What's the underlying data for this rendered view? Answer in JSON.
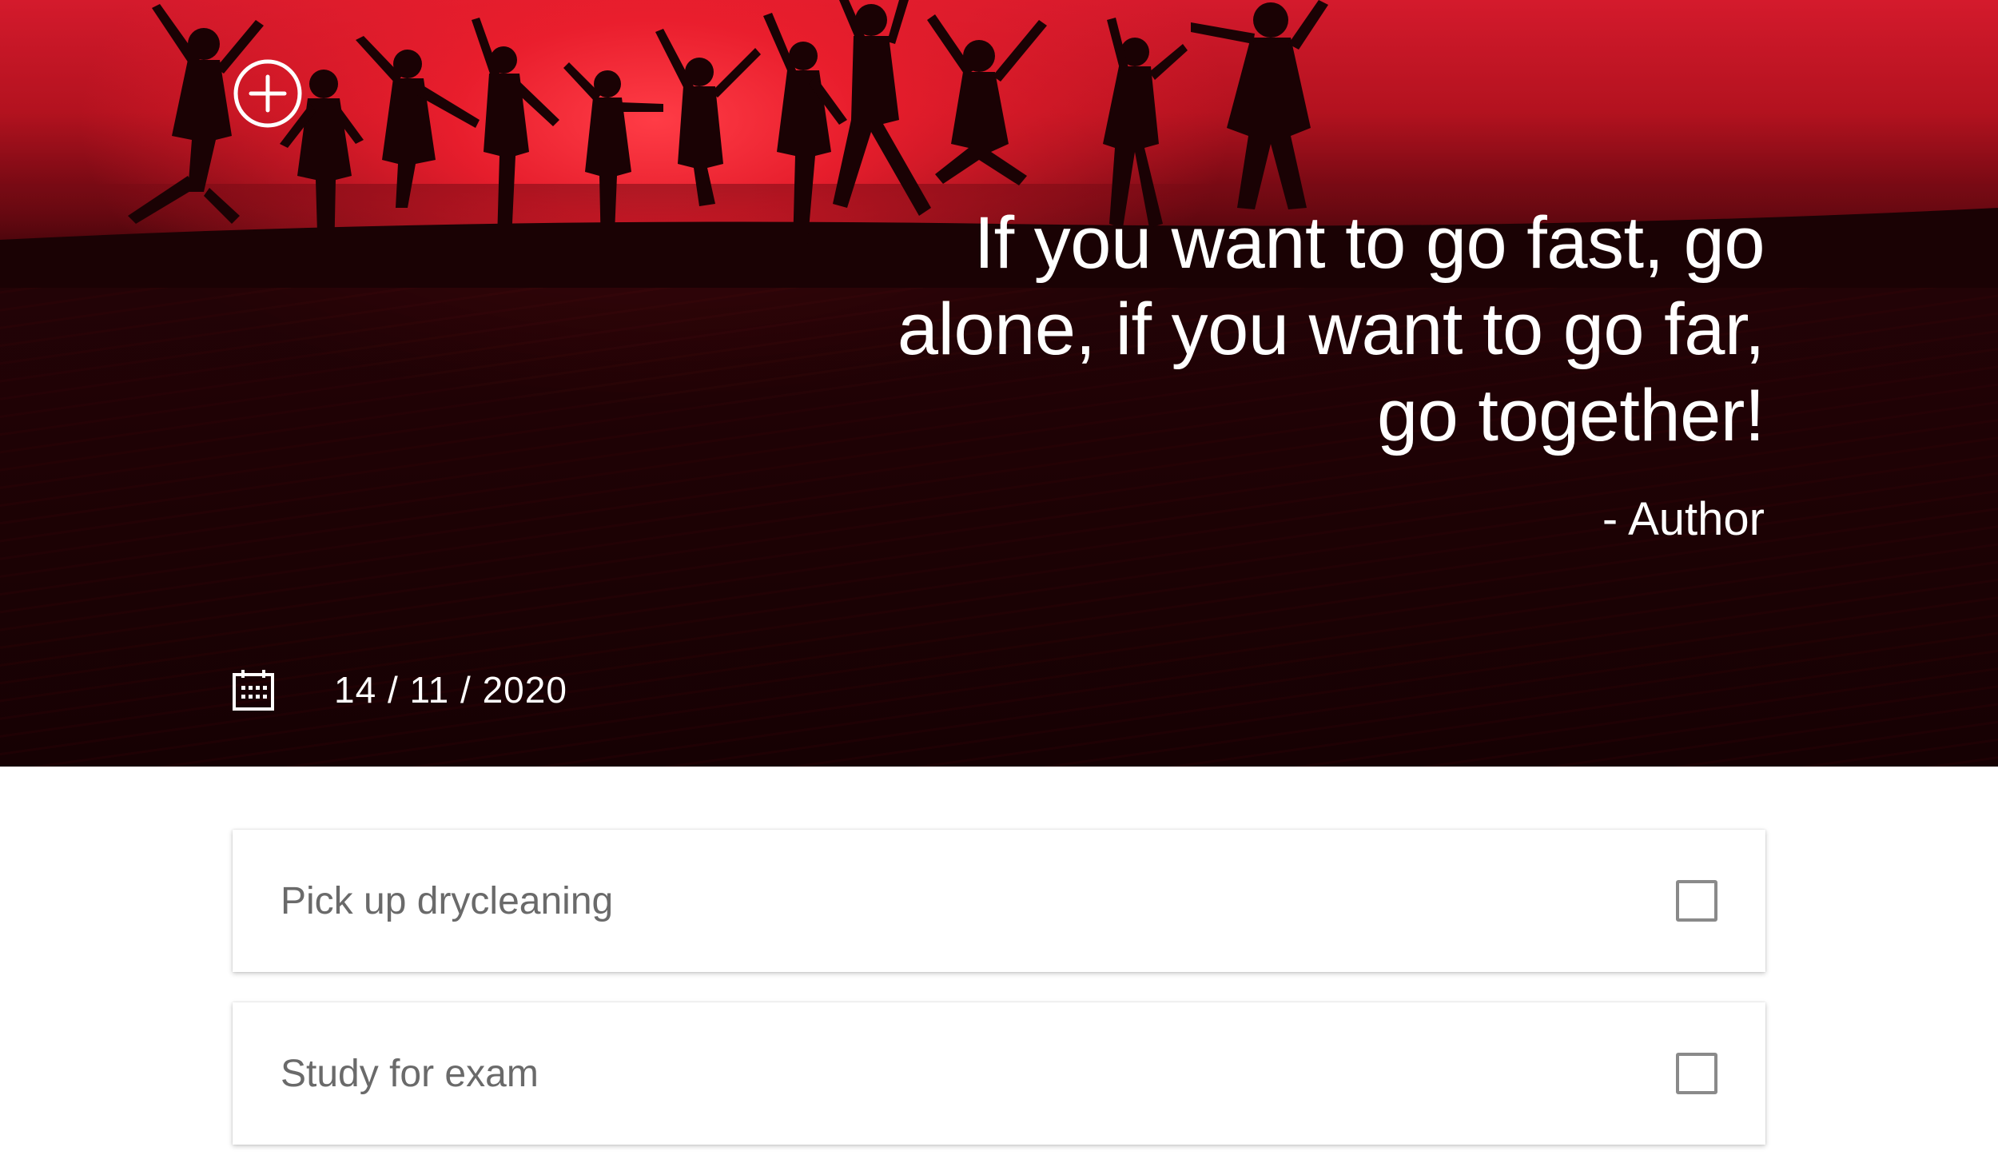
{
  "hero": {
    "quote": "If you want to go fast, go alone, if you want to go far, go together!",
    "author": "- Author",
    "date": "14 / 11 / 2020",
    "add_icon": "plus-circle-icon",
    "calendar_icon": "calendar-icon"
  },
  "tasks": [
    {
      "label": "Pick up drycleaning",
      "checked": false
    },
    {
      "label": "Study for exam",
      "checked": false
    }
  ],
  "colors": {
    "accent": "#d41a2c",
    "text_primary": "#ffffff",
    "task_text": "#6a6a6a"
  }
}
